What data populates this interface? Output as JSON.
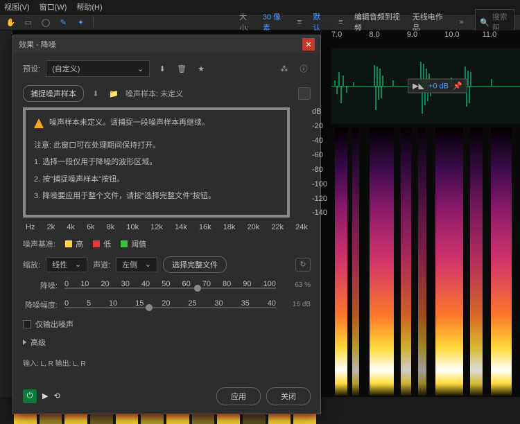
{
  "menu": {
    "view": "视图(V)",
    "window": "窗口(W)",
    "help": "帮助(H)"
  },
  "toolbar": {
    "size_label": "大小:",
    "size_value": "30 像素",
    "default_tab": "默认",
    "edit_audio": "编辑音频到视频",
    "radio": "无线电作品",
    "search_placeholder": "搜索帮"
  },
  "dialog": {
    "title": "效果 - 降噪",
    "preset_label": "预设:",
    "preset_value": "(自定义)",
    "capture_btn": "捕捉噪声样本",
    "noise_sample_label": "噪声样本: 未定义",
    "warn1": "噪声样本未定义。请捕捉一段噪声样本再继续。",
    "warn2": "注意: 此窗口可在处理期间保持打开。",
    "warn3": "1. 选择一段仅用于降噪的波形区域。",
    "warn4": "2. 按\"捕捉噪声样本\"按钮。",
    "warn5": "3. 降噪要应用于整个文件，请按\"选择完整文件\"按钮。",
    "db_ticks": [
      "dB",
      "-20",
      "-40",
      "-60",
      "-80",
      "-100",
      "-120",
      "-140"
    ],
    "hz_label": "Hz",
    "hz_ticks": [
      "2k",
      "4k",
      "6k",
      "8k",
      "10k",
      "12k",
      "14k",
      "16k",
      "18k",
      "20k",
      "22k",
      "24k"
    ],
    "legend_label": "噪声基准:",
    "legend_high": "高",
    "legend_low": "低",
    "legend_thresh": "阈值",
    "scale_label": "缩放:",
    "scale_value": "线性",
    "channel_label": "声道:",
    "channel_value": "左侧",
    "select_all_btn": "选择完整文件",
    "nr_label": "降噪:",
    "nr_ticks": [
      "0",
      "10",
      "20",
      "30",
      "40",
      "50",
      "60",
      "70",
      "80",
      "90",
      "100"
    ],
    "nr_value": "63 %",
    "amp_label": "降噪幅度:",
    "amp_ticks": [
      "0",
      "5",
      "10",
      "15",
      "20",
      "25",
      "30",
      "35",
      "40"
    ],
    "amp_value": "16 dB",
    "output_noise": "仅输出噪声",
    "advanced": "高级",
    "io": "输入: L, R   输出: L, R",
    "apply": "应用",
    "close": "关闭"
  },
  "timeline": {
    "ticks": [
      "7.0",
      "8.0",
      "9.0",
      "10.0",
      "11.0"
    ]
  },
  "db_control": {
    "value": "+0 dB"
  }
}
